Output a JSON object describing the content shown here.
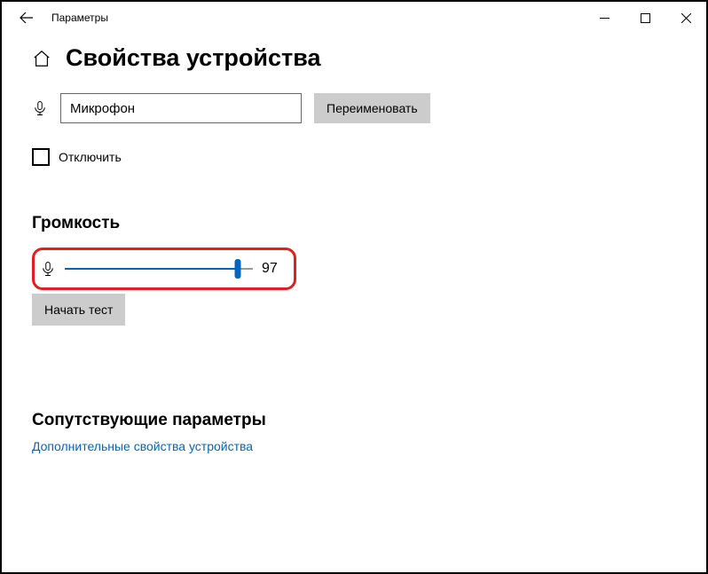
{
  "app_title": "Параметры",
  "page_title": "Свойства устройства",
  "device_name": "Микрофон",
  "rename_button": "Переименовать",
  "disable_label": "Отключить",
  "volume_header": "Громкость",
  "volume_value": "97",
  "volume_percent": 92,
  "test_button": "Начать тест",
  "related_header": "Сопутствующие параметры",
  "related_link": "Дополнительные свойства устройства"
}
